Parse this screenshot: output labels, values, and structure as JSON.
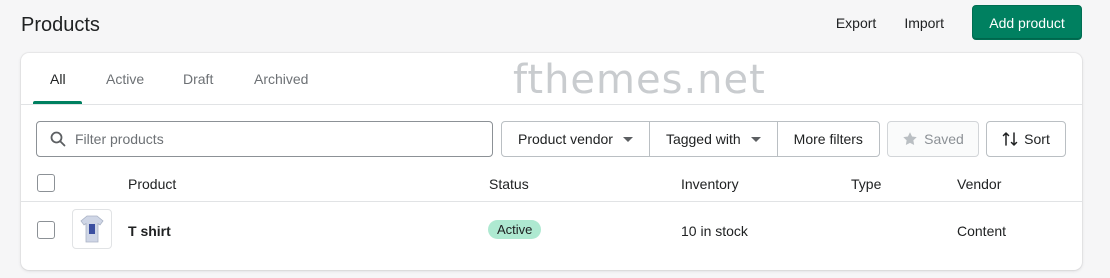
{
  "header": {
    "title": "Products",
    "export_label": "Export",
    "import_label": "Import",
    "add_label": "Add product",
    "accent": "#008060"
  },
  "watermark": "fthemes.net",
  "tabs": [
    {
      "label": "All",
      "active": true
    },
    {
      "label": "Active",
      "active": false
    },
    {
      "label": "Draft",
      "active": false
    },
    {
      "label": "Archived",
      "active": false
    }
  ],
  "filters": {
    "search_placeholder": "Filter products",
    "vendor_label": "Product vendor",
    "tagged_label": "Tagged with",
    "more_label": "More filters",
    "saved_label": "Saved",
    "sort_label": "Sort"
  },
  "table": {
    "columns": [
      "Product",
      "Status",
      "Inventory",
      "Type",
      "Vendor"
    ],
    "rows": [
      {
        "product": "T shirt",
        "status": "Active",
        "inventory": "10 in stock",
        "type": "",
        "vendor": "Content"
      }
    ]
  }
}
